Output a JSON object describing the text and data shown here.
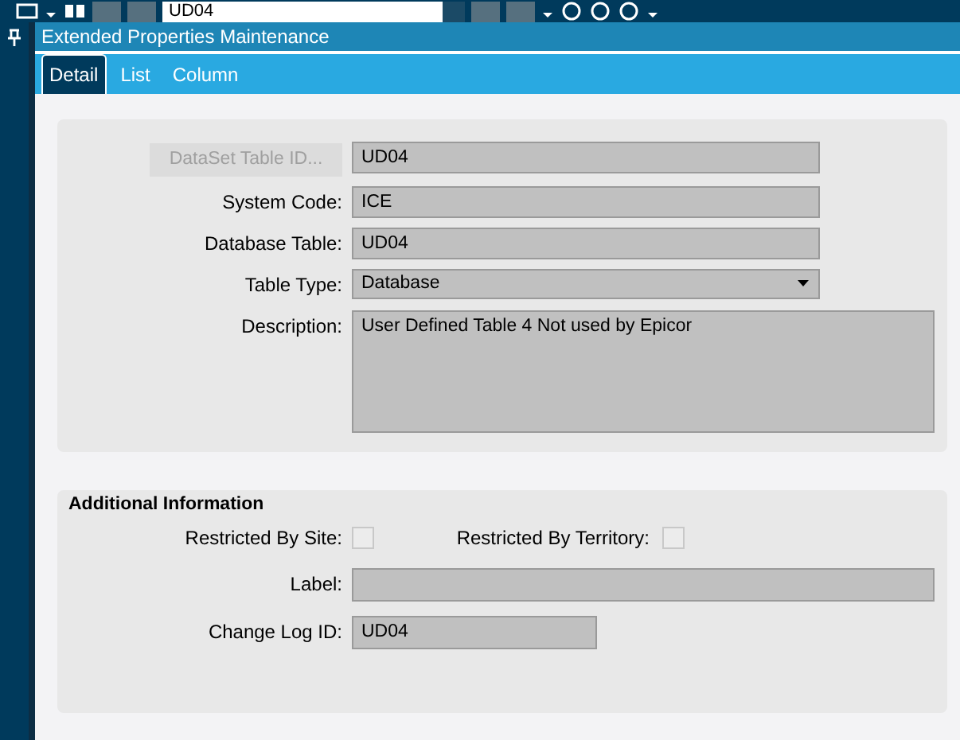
{
  "toolbar": {
    "record_field": {
      "value": "UD04"
    }
  },
  "window": {
    "title": "Extended Properties Maintenance"
  },
  "tabs": [
    {
      "label": "Detail",
      "selected": true
    },
    {
      "label": "List",
      "selected": false
    },
    {
      "label": "Column",
      "selected": false
    }
  ],
  "detail": {
    "fields": [
      {
        "kind": "button",
        "label": "DataSet Table ID...",
        "disabled": true,
        "value": "UD04"
      },
      {
        "kind": "text",
        "label": "System Code:",
        "value": "ICE"
      },
      {
        "kind": "text",
        "label": "Database Table:",
        "value": "UD04"
      },
      {
        "kind": "dropdown",
        "label": "Table Type:",
        "value": "Database"
      },
      {
        "kind": "textarea",
        "label": "Description:",
        "value": "User Defined Table 4 Not used by Epicor"
      }
    ]
  },
  "additional_information": {
    "title": "Additional Information",
    "checkboxes": [
      {
        "label": "Restricted By Site:",
        "checked": false
      },
      {
        "label": "Restricted By Territory:",
        "checked": false
      }
    ],
    "fields": [
      {
        "kind": "wide",
        "label": "Label:"
      },
      {
        "kind": "short",
        "label": "Change Log ID:",
        "value": "UD04"
      }
    ]
  }
}
